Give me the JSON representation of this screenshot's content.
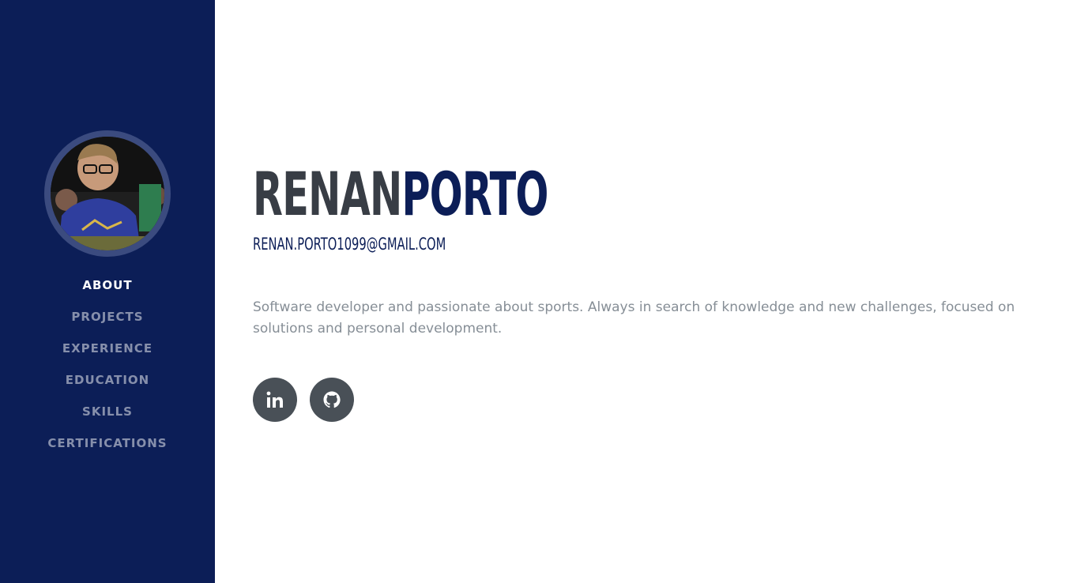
{
  "profile": {
    "avatar_alt": "profile photo"
  },
  "nav": {
    "items": [
      {
        "label": "ABOUT",
        "active": true
      },
      {
        "label": "PROJECTS",
        "active": false
      },
      {
        "label": "EXPERIENCE",
        "active": false
      },
      {
        "label": "EDUCATION",
        "active": false
      },
      {
        "label": "SKILLS",
        "active": false
      },
      {
        "label": "CERTIFICATIONS",
        "active": false
      }
    ]
  },
  "hero": {
    "first_name": "RENAN",
    "last_name": "PORTO",
    "email": "RENAN.PORTO1099@GMAIL.COM",
    "bio": "Software developer and passionate about sports. Always in search of knowledge and new challenges, focused on solutions and personal development."
  },
  "social": [
    {
      "icon": "linkedin-icon",
      "label": "in"
    },
    {
      "icon": "github-icon"
    }
  ],
  "colors": {
    "sidebar": "#0c1e57",
    "accent": "#0c1e57",
    "name_dark": "#383d45",
    "bio_text": "#868e96",
    "social_button": "#495057"
  }
}
